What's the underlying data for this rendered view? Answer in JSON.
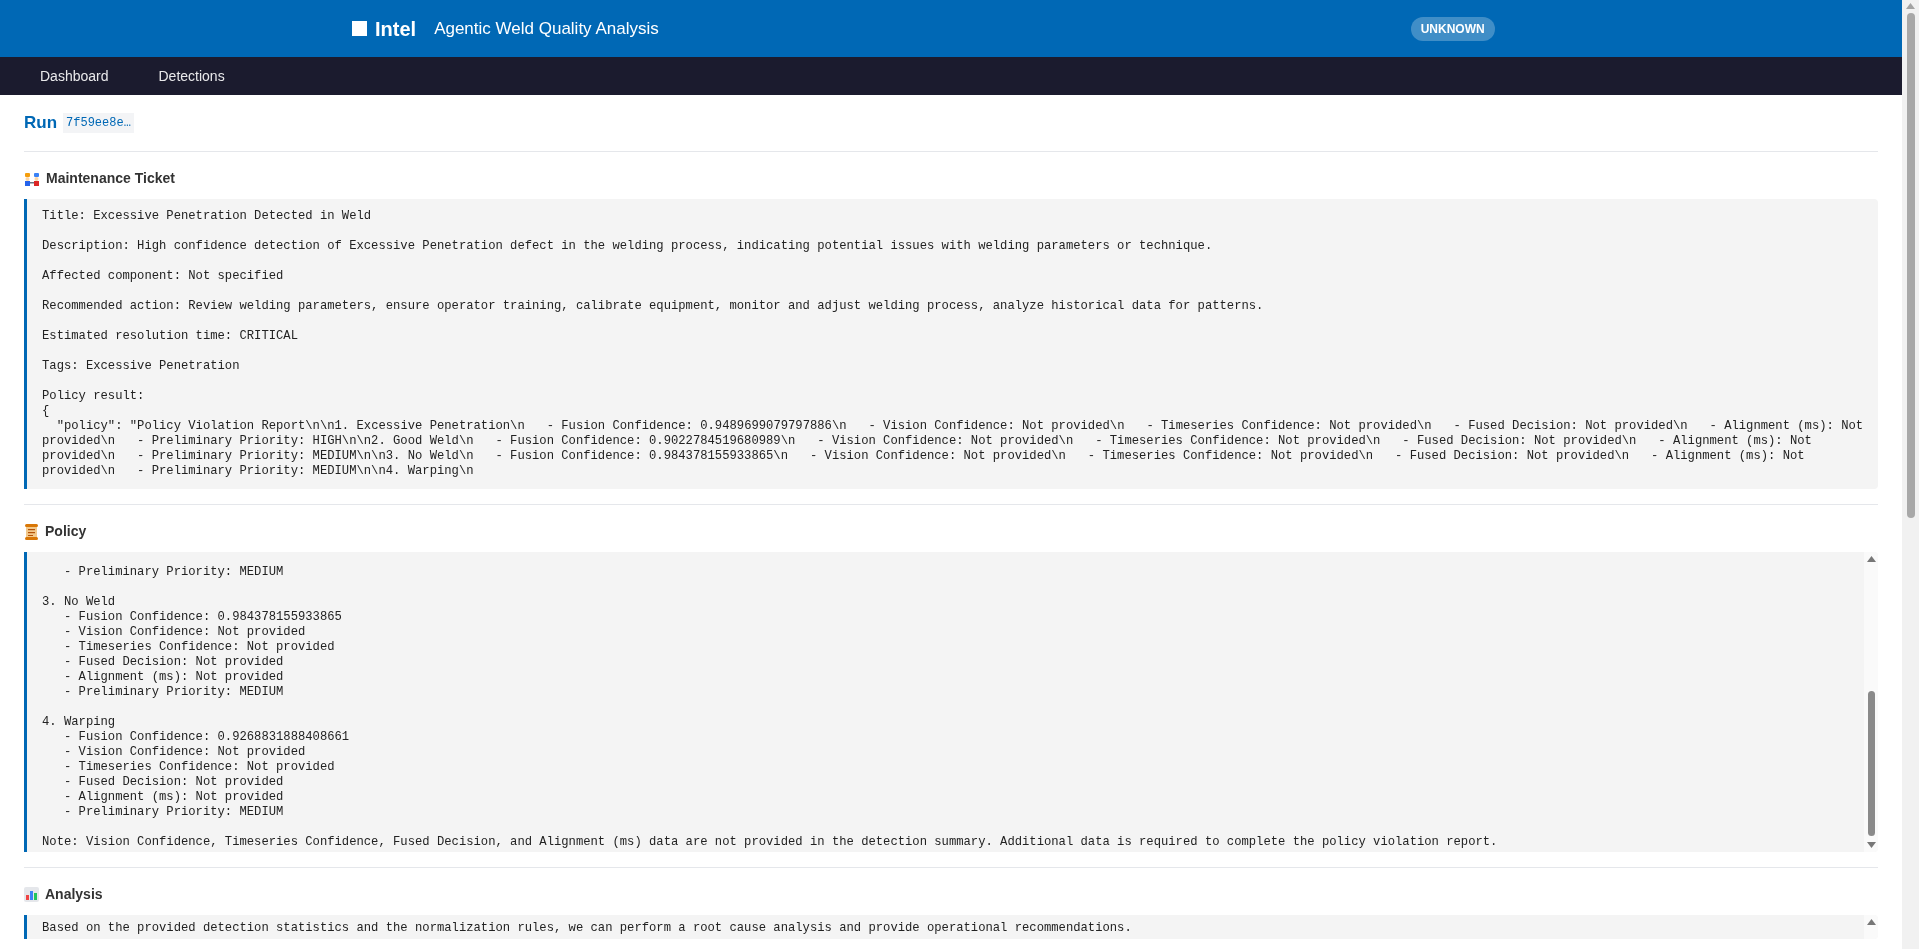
{
  "header": {
    "brand": "Intel",
    "title": "Agentic Weld Quality Analysis",
    "status": "UNKNOWN"
  },
  "nav": [
    {
      "label": "Dashboard"
    },
    {
      "label": "Detections"
    }
  ],
  "run": {
    "label": "Run",
    "id": "7f59ee8e…"
  },
  "sections": [
    {
      "kind": "ticket",
      "title": "Maintenance Ticket",
      "paragraphs": [
        [
          "Title: Excessive Penetration Detected in Weld"
        ],
        [
          "Description: High confidence detection of Excessive Penetration defect in the welding process, indicating potential issues with welding parameters or technique."
        ],
        [
          "Affected component: Not specified"
        ],
        [
          "Recommended action: Review welding parameters, ensure operator training, calibrate equipment, monitor and adjust welding process, analyze historical data for patterns."
        ],
        [
          "Estimated resolution time: CRITICAL"
        ],
        [
          "Tags: Excessive Penetration"
        ],
        [
          "Policy result:",
          "{",
          "  \"policy\": \"Policy Violation Report\\n\\n1. Excessive Penetration\\n   - Fusion Confidence: 0.9489699079797886\\n   - Vision Confidence: Not provided\\n   - Timeseries Confidence: Not provided\\n   - Fused Decision: Not provided\\n   - Alignment (ms): Not provided\\n   - Preliminary Priority: HIGH\\n\\n2. Good Weld\\n   - Fusion Confidence: 0.9022784519680989\\n   - Vision Confidence: Not provided\\n   - Timeseries Confidence: Not provided\\n   - Fused Decision: Not provided\\n   - Alignment (ms): Not provided\\n   - Preliminary Priority: MEDIUM\\n\\n3. No Weld\\n   - Fusion Confidence: 0.984378155933865\\n   - Vision Confidence: Not provided\\n   - Timeseries Confidence: Not provided\\n   - Fused Decision: Not provided\\n   - Alignment (ms): Not provided\\n   - Preliminary Priority: MEDIUM\\n\\n4. Warping\\n"
        ]
      ]
    },
    {
      "kind": "policy",
      "title": "Policy",
      "paragraphs": [
        [
          "   - Preliminary Priority: MEDIUM"
        ],
        [
          "3. No Weld",
          "   - Fusion Confidence: 0.984378155933865",
          "   - Vision Confidence: Not provided",
          "   - Timeseries Confidence: Not provided",
          "   - Fused Decision: Not provided",
          "   - Alignment (ms): Not provided",
          "   - Preliminary Priority: MEDIUM"
        ],
        [
          "4. Warping",
          "   - Fusion Confidence: 0.9268831888408661",
          "   - Vision Confidence: Not provided",
          "   - Timeseries Confidence: Not provided",
          "   - Fused Decision: Not provided",
          "   - Alignment (ms): Not provided",
          "   - Preliminary Priority: MEDIUM"
        ],
        [
          "Note: Vision Confidence, Timeseries Confidence, Fused Decision, and Alignment (ms) data are not provided in the detection summary. Additional data is required to complete the policy violation report."
        ]
      ]
    },
    {
      "kind": "analysis",
      "title": "Analysis",
      "paragraphs": [
        [
          "Based on the provided detection statistics and the normalization rules, we can perform a root cause analysis and provide operational recommendations."
        ]
      ]
    }
  ]
}
